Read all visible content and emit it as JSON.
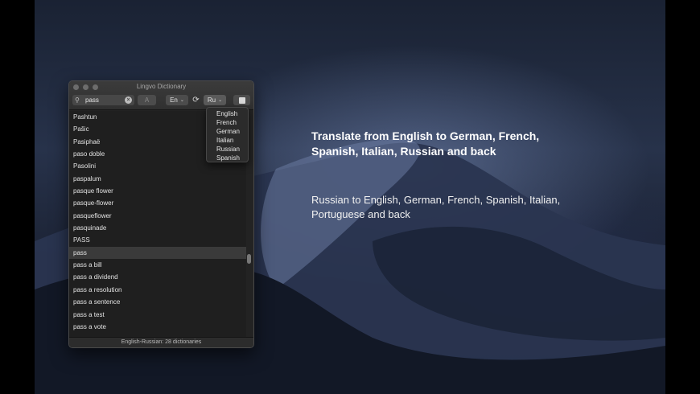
{
  "window": {
    "title": "Lingvo Dictionary",
    "search": {
      "value": "pass",
      "search_icon": "magnifier-icon",
      "clear_icon": "clear-icon",
      "clear_glyph": "×"
    },
    "toolbar": {
      "a_label": "A",
      "from_lang": "En",
      "swap_glyph": "⟳",
      "to_lang": "Ru",
      "chevron_glyph": "⌄"
    },
    "dropdown_options": [
      "English",
      "French",
      "German",
      "Italian",
      "Russian",
      "Spanish"
    ],
    "list_items": [
      "Pashtun",
      "Pašic",
      "Pasiphaë",
      "paso doble",
      "Pasolini",
      "paspalum",
      "pasque flower",
      "pasque-flower",
      "pasqueflower",
      "pasquinade",
      "PASS",
      "pass",
      "pass a bill",
      "pass a dividend",
      "pass a resolution",
      "pass a sentence",
      "pass a test",
      "pass a vote"
    ],
    "selected_item": "pass",
    "status": "English-Russian: 28 dictionaries"
  },
  "promo": {
    "headline": "Translate from English to German, French, Spanish, Italian, Russian and back",
    "subline": "Russian to English, German, French, Spanish, Italian, Portuguese and back"
  },
  "colors": {
    "window_bg": "#232323",
    "list_bg": "#1f1f1f",
    "selection": "#3a3a3a",
    "text": "#e2e2e2"
  }
}
